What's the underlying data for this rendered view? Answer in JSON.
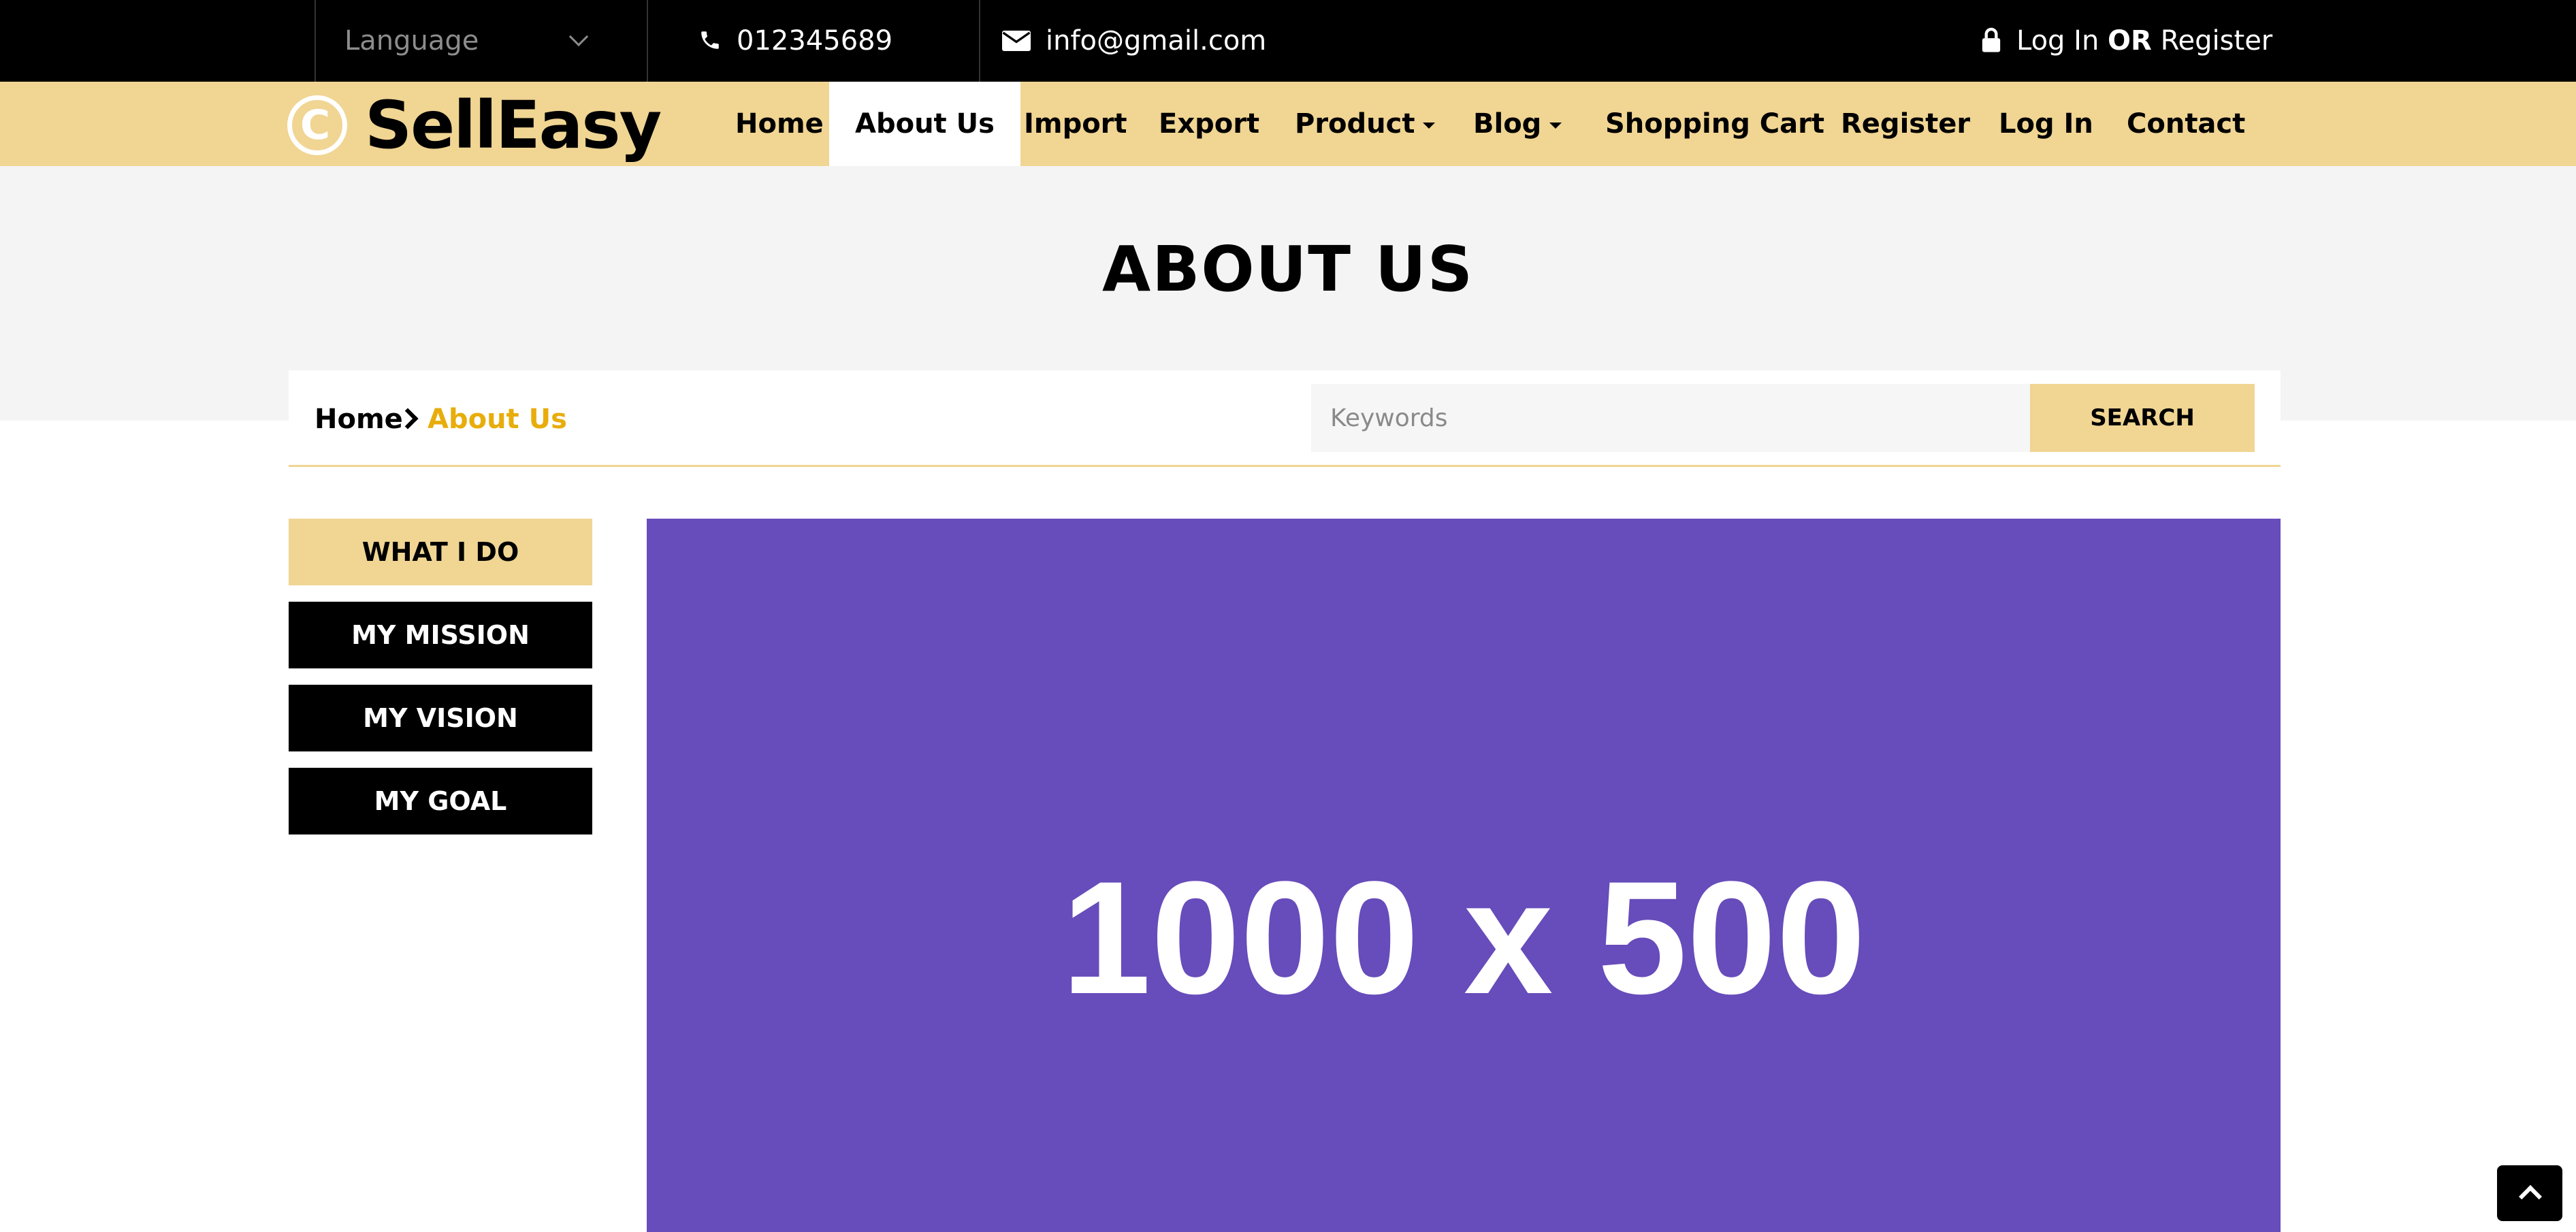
{
  "topbar": {
    "language_label": "Language",
    "phone": "012345689",
    "email": "info@gmail.com",
    "login": "Log In",
    "or": "OR",
    "register": "Register"
  },
  "brand": {
    "logo_mark": "C",
    "name": "SellEasy"
  },
  "nav": {
    "items": [
      {
        "label": "Home"
      },
      {
        "label": "About Us"
      },
      {
        "label": "Import"
      },
      {
        "label": "Export"
      },
      {
        "label": "Product"
      },
      {
        "label": "Blog"
      },
      {
        "label": "Shopping Cart"
      },
      {
        "label": "Register"
      },
      {
        "label": "Log In"
      },
      {
        "label": "Contact"
      }
    ],
    "active": "About Us"
  },
  "page": {
    "title": "ABOUT US"
  },
  "breadcrumb": {
    "home": "Home",
    "current": "About Us"
  },
  "search": {
    "placeholder": "Keywords",
    "button_label": "SEARCH"
  },
  "sidebar": {
    "items": [
      {
        "label": "WHAT I DO"
      },
      {
        "label": "MY MISSION"
      },
      {
        "label": "MY VISION"
      },
      {
        "label": "MY GOAL"
      }
    ],
    "active": "WHAT I DO"
  },
  "hero": {
    "placeholder_text": "1000 x 500"
  },
  "icons": {
    "chevron_down": "chevron-down-icon",
    "phone": "phone-icon",
    "mail": "envelope-icon",
    "lock": "lock-icon",
    "breadcrumb_separator": "chevron-right-icon",
    "scroll_top": "arrow-up-icon"
  },
  "colors": {
    "topbar": "#000000",
    "nav_background": "#f0d593",
    "accent_text": "#e8ad0c",
    "hero_background": "#674cbb"
  }
}
